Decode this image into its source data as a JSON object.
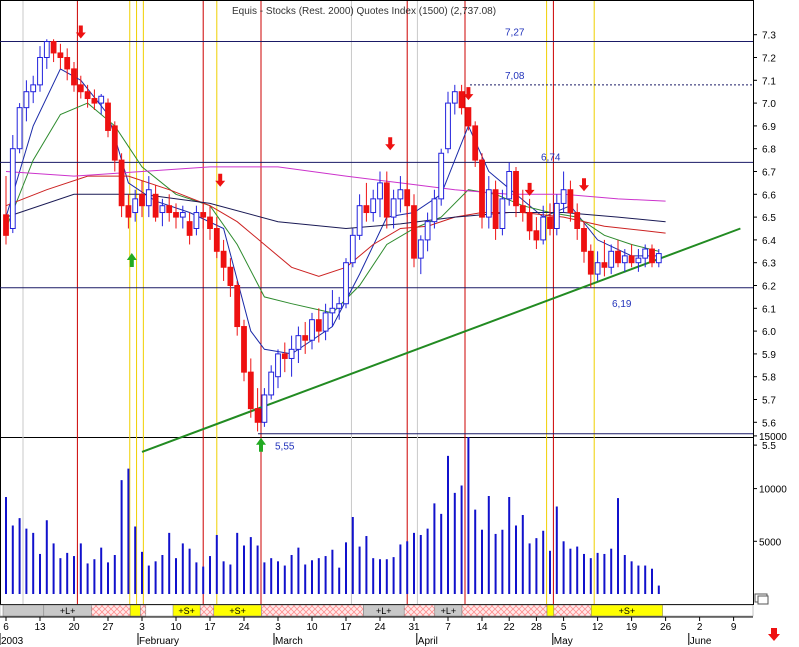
{
  "title": "Equis - Stocks (Rest. 2000) Quotes Index (1500) (2,737.08)",
  "colors": {
    "bull": "#2222dd",
    "bear": "#ee1111",
    "volume": "#1111cc",
    "ma_blue": "#1a2aa8",
    "ma_green": "#2e8b2e",
    "ma_red": "#cc2222",
    "ma_navy": "#1a1a55",
    "ma_magenta": "#cc33cc",
    "trendline": "#228b22",
    "red_vline": "#cc0000",
    "yellow_vline": "#f0d000",
    "gray_vline": "#c8c8c8",
    "level_line": "#1a1a66",
    "band_gray": "#c8c8c8",
    "band_yellow": "#ffff00",
    "band_hatch": "#ffb0b0"
  },
  "price_axis": {
    "ymin": 5.4,
    "ymax": 7.4,
    "ticks": [
      "7.3",
      "7.2",
      "7.1",
      "7.0",
      "6.9",
      "6.8",
      "6.7",
      "6.6",
      "6.5",
      "6.4",
      "6.3",
      "6.2",
      "6.1",
      "6.0",
      "5.9",
      "5.8",
      "5.7",
      "5.6",
      "5.5"
    ]
  },
  "volume_axis": {
    "ymax": 16500,
    "ticks": [
      "15000",
      "10000",
      "5000"
    ]
  },
  "x_axis": {
    "day_ticks": [
      {
        "label": "6",
        "i": 0
      },
      {
        "label": "13",
        "i": 5
      },
      {
        "label": "20",
        "i": 10
      },
      {
        "label": "27",
        "i": 15
      },
      {
        "label": "3",
        "i": 20
      },
      {
        "label": "10",
        "i": 25
      },
      {
        "label": "17",
        "i": 30
      },
      {
        "label": "24",
        "i": 35
      },
      {
        "label": "3",
        "i": 40
      },
      {
        "label": "10",
        "i": 45
      },
      {
        "label": "17",
        "i": 50
      },
      {
        "label": "24",
        "i": 55
      },
      {
        "label": "31",
        "i": 60
      },
      {
        "label": "7",
        "i": 65
      },
      {
        "label": "14",
        "i": 70
      },
      {
        "label": "22",
        "i": 74
      },
      {
        "label": "28",
        "i": 78
      },
      {
        "label": "5",
        "i": 82
      },
      {
        "label": "12",
        "i": 87
      },
      {
        "label": "19",
        "i": 92
      },
      {
        "label": "26",
        "i": 97
      },
      {
        "label": "2",
        "i": 102
      },
      {
        "label": "9",
        "i": 107
      }
    ],
    "months": [
      {
        "label": "2003",
        "i": -0.6
      },
      {
        "label": "February",
        "i": 20
      },
      {
        "label": "March",
        "i": 40
      },
      {
        "label": "April",
        "i": 61
      },
      {
        "label": "May",
        "i": 81
      },
      {
        "label": "June",
        "i": 101
      }
    ]
  },
  "levels": [
    {
      "value": 7.27,
      "label": "7,27",
      "style": "solid"
    },
    {
      "value": 7.08,
      "label": "7,08",
      "style": "dotted"
    },
    {
      "value": 6.74,
      "label": "6,74",
      "style": "solid"
    },
    {
      "value": 6.19,
      "label": "6,19",
      "style": "solid"
    },
    {
      "value": 5.55,
      "label": "5,55",
      "style": "solid"
    }
  ],
  "trendline": {
    "from": {
      "i": 20,
      "v": 5.47
    },
    "to": {
      "i": 108,
      "v": 6.45
    }
  },
  "vlines": {
    "red": [
      10.5,
      29,
      37.5,
      59,
      67.5,
      80.5
    ],
    "yellow": [
      18.2,
      19.2,
      20.2,
      31,
      79.5,
      86.5
    ],
    "gray": [
      2.5,
      50.8,
      60.5
    ]
  },
  "arrows": [
    {
      "i": 11,
      "v": 7.27,
      "dir": "down"
    },
    {
      "i": 31.5,
      "v": 6.62,
      "dir": "down"
    },
    {
      "i": 56.5,
      "v": 6.78,
      "dir": "down"
    },
    {
      "i": 68,
      "v": 7.0,
      "dir": "down"
    },
    {
      "i": 77,
      "v": 6.58,
      "dir": "down"
    },
    {
      "i": 85,
      "v": 6.6,
      "dir": "down"
    },
    {
      "i": 18.5,
      "v": 6.36,
      "dir": "up"
    },
    {
      "i": 37.5,
      "v": 5.55,
      "dir": "up"
    }
  ],
  "bands": [
    {
      "from": 0,
      "to": 6,
      "type": "gray"
    },
    {
      "from": 6,
      "to": 13,
      "type": "gray",
      "label": "+L+"
    },
    {
      "from": 13,
      "to": 18.7,
      "type": "hatch"
    },
    {
      "from": 18.7,
      "to": 20.2,
      "type": "yellow"
    },
    {
      "from": 20.2,
      "to": 21,
      "type": "hatch"
    },
    {
      "from": 25,
      "to": 29,
      "type": "yellow",
      "label": "+S+"
    },
    {
      "from": 29,
      "to": 31,
      "type": "hatch"
    },
    {
      "from": 31,
      "to": 38,
      "type": "yellow",
      "label": "+S+"
    },
    {
      "from": 38,
      "to": 53,
      "type": "hatch"
    },
    {
      "from": 53,
      "to": 59,
      "type": "gray",
      "label": "+L+"
    },
    {
      "from": 59,
      "to": 63.5,
      "type": "hatch"
    },
    {
      "from": 63.5,
      "to": 67.5,
      "type": "gray",
      "label": "+L+"
    },
    {
      "from": 67.5,
      "to": 80,
      "type": "hatch"
    },
    {
      "from": 80,
      "to": 81,
      "type": "yellow"
    },
    {
      "from": 81,
      "to": 86.5,
      "type": "hatch"
    },
    {
      "from": 86.5,
      "to": 97,
      "type": "yellow",
      "label": "+S+"
    }
  ],
  "chart_data": {
    "type": "candlestick",
    "title": "Equis - Stocks (Rest. 2000) Quotes Index (1500) (2,737.08)",
    "date_range": "January 2003 - May 2003",
    "candles": [
      [
        6.51,
        6.68,
        6.38,
        6.42
      ],
      [
        6.45,
        6.86,
        6.43,
        6.8
      ],
      [
        6.8,
        7.0,
        6.78,
        6.98
      ],
      [
        6.98,
        7.1,
        6.92,
        7.05
      ],
      [
        7.05,
        7.12,
        7.0,
        7.08
      ],
      [
        7.08,
        7.25,
        7.05,
        7.2
      ],
      [
        7.2,
        7.28,
        7.15,
        7.27
      ],
      [
        7.27,
        7.28,
        7.18,
        7.22
      ],
      [
        7.22,
        7.26,
        7.15,
        7.2
      ],
      [
        7.2,
        7.24,
        7.1,
        7.15
      ],
      [
        7.15,
        7.18,
        7.05,
        7.08
      ],
      [
        7.08,
        7.12,
        7.02,
        7.05
      ],
      [
        7.05,
        7.08,
        6.98,
        7.02
      ],
      [
        7.02,
        7.06,
        6.97,
        7.0
      ],
      [
        7.0,
        7.04,
        6.95,
        7.03
      ],
      [
        7.0,
        7.02,
        6.85,
        6.88
      ],
      [
        6.9,
        6.92,
        6.7,
        6.75
      ],
      [
        6.75,
        6.78,
        6.5,
        6.55
      ],
      [
        6.55,
        6.6,
        6.45,
        6.5
      ],
      [
        6.52,
        6.62,
        6.48,
        6.58
      ],
      [
        6.6,
        6.66,
        6.5,
        6.55
      ],
      [
        6.55,
        6.68,
        6.5,
        6.62
      ],
      [
        6.6,
        6.64,
        6.48,
        6.5
      ],
      [
        6.52,
        6.58,
        6.46,
        6.55
      ],
      [
        6.55,
        6.6,
        6.48,
        6.52
      ],
      [
        6.52,
        6.56,
        6.45,
        6.5
      ],
      [
        6.5,
        6.55,
        6.45,
        6.52
      ],
      [
        6.48,
        6.52,
        6.38,
        6.42
      ],
      [
        6.45,
        6.55,
        6.42,
        6.52
      ],
      [
        6.52,
        6.56,
        6.45,
        6.5
      ],
      [
        6.5,
        6.55,
        6.4,
        6.45
      ],
      [
        6.45,
        6.5,
        6.32,
        6.35
      ],
      [
        6.35,
        6.4,
        6.22,
        6.28
      ],
      [
        6.28,
        6.32,
        6.15,
        6.2
      ],
      [
        6.2,
        6.22,
        5.98,
        6.02
      ],
      [
        6.02,
        6.05,
        5.78,
        5.82
      ],
      [
        5.82,
        5.88,
        5.62,
        5.66
      ],
      [
        5.66,
        5.75,
        5.56,
        5.6
      ],
      [
        5.6,
        5.75,
        5.58,
        5.72
      ],
      [
        5.72,
        5.85,
        5.7,
        5.82
      ],
      [
        5.8,
        5.92,
        5.75,
        5.9
      ],
      [
        5.9,
        5.95,
        5.82,
        5.88
      ],
      [
        5.88,
        5.98,
        5.8,
        5.92
      ],
      [
        5.92,
        6.02,
        5.86,
        5.98
      ],
      [
        5.98,
        6.04,
        5.9,
        5.96
      ],
      [
        5.96,
        6.08,
        5.92,
        6.05
      ],
      [
        6.05,
        6.1,
        5.95,
        6.0
      ],
      [
        6.0,
        6.12,
        5.96,
        6.08
      ],
      [
        6.08,
        6.18,
        6.02,
        6.1
      ],
      [
        6.1,
        6.15,
        6.05,
        6.12
      ],
      [
        6.12,
        6.32,
        6.1,
        6.3
      ],
      [
        6.3,
        6.45,
        6.28,
        6.42
      ],
      [
        6.42,
        6.6,
        6.4,
        6.55
      ],
      [
        6.55,
        6.65,
        6.48,
        6.52
      ],
      [
        6.52,
        6.62,
        6.48,
        6.58
      ],
      [
        6.58,
        6.7,
        6.5,
        6.65
      ],
      [
        6.65,
        6.7,
        6.45,
        6.5
      ],
      [
        6.5,
        6.62,
        6.45,
        6.58
      ],
      [
        6.58,
        6.68,
        6.52,
        6.62
      ],
      [
        6.62,
        6.66,
        6.5,
        6.55
      ],
      [
        6.55,
        6.6,
        6.28,
        6.32
      ],
      [
        6.32,
        6.42,
        6.25,
        6.4
      ],
      [
        6.4,
        6.52,
        6.35,
        6.48
      ],
      [
        6.48,
        6.62,
        6.45,
        6.58
      ],
      [
        6.58,
        6.8,
        6.55,
        6.78
      ],
      [
        6.8,
        7.05,
        6.78,
        7.0
      ],
      [
        7.0,
        7.08,
        6.95,
        7.05
      ],
      [
        7.05,
        7.08,
        6.95,
        6.98
      ],
      [
        6.98,
        6.98,
        6.88,
        6.9
      ],
      [
        6.9,
        6.92,
        6.72,
        6.75
      ],
      [
        6.75,
        6.78,
        6.45,
        6.5
      ],
      [
        6.5,
        6.68,
        6.45,
        6.62
      ],
      [
        6.62,
        6.66,
        6.4,
        6.45
      ],
      [
        6.45,
        6.62,
        6.42,
        6.58
      ],
      [
        6.58,
        6.74,
        6.55,
        6.7
      ],
      [
        6.7,
        6.72,
        6.5,
        6.55
      ],
      [
        6.55,
        6.62,
        6.48,
        6.52
      ],
      [
        6.52,
        6.58,
        6.4,
        6.44
      ],
      [
        6.44,
        6.5,
        6.36,
        6.4
      ],
      [
        6.4,
        6.55,
        6.38,
        6.5
      ],
      [
        6.5,
        6.56,
        6.42,
        6.45
      ],
      [
        6.45,
        6.6,
        6.42,
        6.56
      ],
      [
        6.56,
        6.7,
        6.52,
        6.62
      ],
      [
        6.62,
        6.66,
        6.48,
        6.52
      ],
      [
        6.52,
        6.56,
        6.4,
        6.45
      ],
      [
        6.45,
        6.48,
        6.3,
        6.35
      ],
      [
        6.35,
        6.38,
        6.19,
        6.25
      ],
      [
        6.25,
        6.35,
        6.22,
        6.3
      ],
      [
        6.3,
        6.4,
        6.24,
        6.28
      ],
      [
        6.28,
        6.38,
        6.25,
        6.35
      ],
      [
        6.35,
        6.4,
        6.28,
        6.3
      ],
      [
        6.3,
        6.36,
        6.26,
        6.33
      ],
      [
        6.33,
        6.38,
        6.28,
        6.3
      ],
      [
        6.3,
        6.36,
        6.26,
        6.32
      ],
      [
        6.32,
        6.38,
        6.28,
        6.36
      ],
      [
        6.36,
        6.38,
        6.28,
        6.3
      ],
      [
        6.3,
        6.36,
        6.28,
        6.34
      ]
    ],
    "volume": [
      9200,
      6500,
      7200,
      6200,
      5800,
      3800,
      7000,
      4800,
      3400,
      3900,
      3600,
      4800,
      2900,
      3300,
      4400,
      3000,
      3700,
      10800,
      11900,
      6400,
      4000,
      2700,
      3100,
      3700,
      5800,
      3400,
      4800,
      4300,
      3000,
      2600,
      3600,
      5600,
      3100,
      2800,
      5800,
      4600,
      5400,
      4600,
      3000,
      3400,
      3100,
      2700,
      3700,
      4400,
      2800,
      3200,
      3400,
      3600,
      4200,
      2500,
      4900,
      7300,
      4500,
      5500,
      3400,
      3300,
      3300,
      3500,
      4700,
      5000,
      5800,
      5600,
      6200,
      8600,
      7600,
      13100,
      9600,
      10300,
      14900,
      8000,
      6100,
      9300,
      5700,
      6100,
      9200,
      6500,
      7500,
      4800,
      5300,
      6000,
      4100,
      8300,
      5000,
      4300,
      4500,
      3800,
      3400,
      3900,
      3800,
      4300,
      9100,
      3700,
      3100,
      2700,
      2700,
      2400,
      800
    ],
    "ma_series": [
      {
        "color_key": "ma_blue",
        "points": [
          [
            0,
            6.5
          ],
          [
            4,
            6.9
          ],
          [
            8,
            7.15
          ],
          [
            11,
            7.1
          ],
          [
            15,
            6.95
          ],
          [
            18,
            6.65
          ],
          [
            22,
            6.57
          ],
          [
            27,
            6.52
          ],
          [
            32,
            6.45
          ],
          [
            36,
            6.0
          ],
          [
            38,
            5.92
          ],
          [
            42,
            5.9
          ],
          [
            48,
            6.02
          ],
          [
            52,
            6.25
          ],
          [
            56,
            6.5
          ],
          [
            60,
            6.52
          ],
          [
            64,
            6.6
          ],
          [
            68,
            6.9
          ],
          [
            71,
            6.7
          ],
          [
            75,
            6.6
          ],
          [
            79,
            6.5
          ],
          [
            83,
            6.55
          ],
          [
            87,
            6.4
          ],
          [
            92,
            6.33
          ],
          [
            96,
            6.33
          ]
        ]
      },
      {
        "color_key": "ma_green",
        "points": [
          [
            0,
            6.45
          ],
          [
            4,
            6.75
          ],
          [
            8,
            6.95
          ],
          [
            12,
            7.0
          ],
          [
            16,
            6.9
          ],
          [
            20,
            6.72
          ],
          [
            25,
            6.6
          ],
          [
            30,
            6.55
          ],
          [
            34,
            6.38
          ],
          [
            38,
            6.15
          ],
          [
            42,
            6.12
          ],
          [
            48,
            6.08
          ],
          [
            52,
            6.2
          ],
          [
            56,
            6.38
          ],
          [
            60,
            6.45
          ],
          [
            64,
            6.5
          ],
          [
            68,
            6.62
          ],
          [
            72,
            6.6
          ],
          [
            76,
            6.55
          ],
          [
            80,
            6.52
          ],
          [
            84,
            6.5
          ],
          [
            88,
            6.42
          ],
          [
            92,
            6.38
          ],
          [
            96,
            6.35
          ]
        ]
      },
      {
        "color_key": "ma_red",
        "points": [
          [
            0,
            6.55
          ],
          [
            6,
            6.62
          ],
          [
            12,
            6.68
          ],
          [
            18,
            6.68
          ],
          [
            24,
            6.62
          ],
          [
            30,
            6.55
          ],
          [
            34,
            6.48
          ],
          [
            38,
            6.38
          ],
          [
            42,
            6.28
          ],
          [
            46,
            6.24
          ],
          [
            50,
            6.28
          ],
          [
            54,
            6.38
          ],
          [
            58,
            6.45
          ],
          [
            62,
            6.46
          ],
          [
            66,
            6.5
          ],
          [
            70,
            6.52
          ],
          [
            76,
            6.52
          ],
          [
            82,
            6.5
          ],
          [
            88,
            6.46
          ],
          [
            94,
            6.44
          ],
          [
            97,
            6.43
          ]
        ]
      },
      {
        "color_key": "ma_navy",
        "points": [
          [
            0,
            6.5
          ],
          [
            10,
            6.6
          ],
          [
            20,
            6.6
          ],
          [
            30,
            6.56
          ],
          [
            40,
            6.48
          ],
          [
            50,
            6.45
          ],
          [
            58,
            6.47
          ],
          [
            66,
            6.5
          ],
          [
            74,
            6.52
          ],
          [
            82,
            6.52
          ],
          [
            90,
            6.5
          ],
          [
            97,
            6.48
          ]
        ]
      },
      {
        "color_key": "ma_magenta",
        "points": [
          [
            0,
            6.7
          ],
          [
            10,
            6.68
          ],
          [
            20,
            6.7
          ],
          [
            30,
            6.72
          ],
          [
            40,
            6.72
          ],
          [
            50,
            6.68
          ],
          [
            58,
            6.65
          ],
          [
            66,
            6.62
          ],
          [
            74,
            6.6
          ],
          [
            82,
            6.6
          ],
          [
            90,
            6.58
          ],
          [
            97,
            6.57
          ]
        ]
      }
    ]
  }
}
